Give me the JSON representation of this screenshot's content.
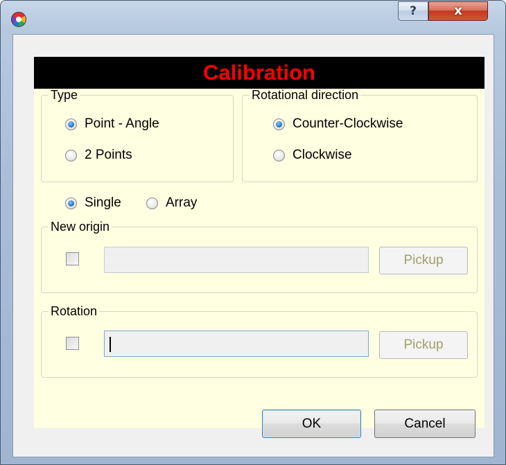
{
  "window": {
    "title": "",
    "help_label": "?",
    "close_label": "x"
  },
  "banner": {
    "title": "Calibration"
  },
  "type_group": {
    "legend": "Type",
    "options": [
      {
        "label": "Point - Angle",
        "selected": true
      },
      {
        "label": "2 Points",
        "selected": false
      }
    ]
  },
  "rotation_direction_group": {
    "legend": "Rotational direction",
    "options": [
      {
        "label": "Counter-Clockwise",
        "selected": true
      },
      {
        "label": "Clockwise",
        "selected": false
      }
    ]
  },
  "mode": {
    "options": [
      {
        "label": "Single",
        "selected": true
      },
      {
        "label": "Array",
        "selected": false
      }
    ]
  },
  "new_origin": {
    "legend": "New origin",
    "checked": false,
    "value": "",
    "pickup_label": "Pickup"
  },
  "rotation": {
    "legend": "Rotation",
    "checked": false,
    "value": "",
    "pickup_label": "Pickup"
  },
  "buttons": {
    "ok_label": "OK",
    "cancel_label": "Cancel"
  },
  "colors": {
    "banner_text": "#ff0000",
    "banner_bg": "#000000",
    "panel_bg": "#ffffe1",
    "pickup_disabled_text": "#a0a06a"
  },
  "icons": {
    "app": "app-logo-icon",
    "help": "help-icon",
    "close": "close-icon"
  }
}
